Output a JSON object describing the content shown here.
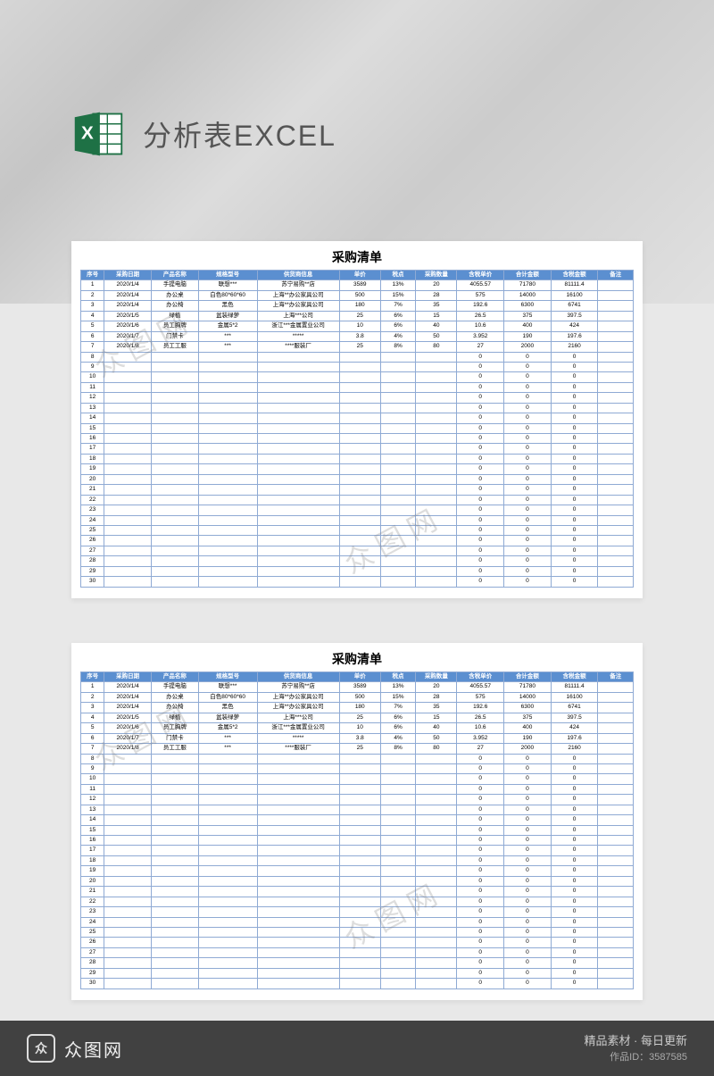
{
  "header": {
    "title": "分析表EXCEL",
    "icon_letter": "X"
  },
  "sheet": {
    "title": "采购清单",
    "columns": [
      "序号",
      "采购日期",
      "产品名称",
      "规格型号",
      "供货商信息",
      "单价",
      "税点",
      "采购数量",
      "含税单价",
      "合计金额",
      "含税金额",
      "备注"
    ],
    "rows": [
      {
        "seq": "1",
        "date": "2020/1/4",
        "name": "手提电脑",
        "spec": "联想***",
        "supplier": "苏宁易购**店",
        "price": "3589",
        "tax": "13%",
        "qty": "20",
        "unit": "4055.57",
        "total": "71780",
        "taxtotal": "81111.4",
        "remark": ""
      },
      {
        "seq": "2",
        "date": "2020/1/4",
        "name": "办公桌",
        "spec": "白色80*60*60",
        "supplier": "上海**办公家具公司",
        "price": "500",
        "tax": "15%",
        "qty": "28",
        "unit": "575",
        "total": "14000",
        "taxtotal": "16100",
        "remark": ""
      },
      {
        "seq": "3",
        "date": "2020/1/4",
        "name": "办公椅",
        "spec": "黑色",
        "supplier": "上海**办公家具公司",
        "price": "180",
        "tax": "7%",
        "qty": "35",
        "unit": "192.6",
        "total": "6300",
        "taxtotal": "6741",
        "remark": ""
      },
      {
        "seq": "4",
        "date": "2020/1/5",
        "name": "绿植",
        "spec": "盆装绿萝",
        "supplier": "上海***公司",
        "price": "25",
        "tax": "6%",
        "qty": "15",
        "unit": "26.5",
        "total": "375",
        "taxtotal": "397.5",
        "remark": ""
      },
      {
        "seq": "5",
        "date": "2020/1/6",
        "name": "员工胸牌",
        "spec": "金属5*2",
        "supplier": "浙江***金属置业公司",
        "price": "10",
        "tax": "6%",
        "qty": "40",
        "unit": "10.6",
        "total": "400",
        "taxtotal": "424",
        "remark": ""
      },
      {
        "seq": "6",
        "date": "2020/1/7",
        "name": "门禁卡",
        "spec": "***",
        "supplier": "*****",
        "price": "3.8",
        "tax": "4%",
        "qty": "50",
        "unit": "3.952",
        "total": "190",
        "taxtotal": "197.6",
        "remark": ""
      },
      {
        "seq": "7",
        "date": "2020/1/8",
        "name": "员工工服",
        "spec": "***",
        "supplier": "****服装厂",
        "price": "25",
        "tax": "8%",
        "qty": "80",
        "unit": "27",
        "total": "2000",
        "taxtotal": "2160",
        "remark": ""
      }
    ],
    "empty_row_count": 23
  },
  "watermark": {
    "text": "众图网"
  },
  "footer": {
    "brand": "众图网",
    "logo_letter": "众",
    "slogan": "精品素材 · 每日更新",
    "id_label": "作品ID：3587585"
  }
}
